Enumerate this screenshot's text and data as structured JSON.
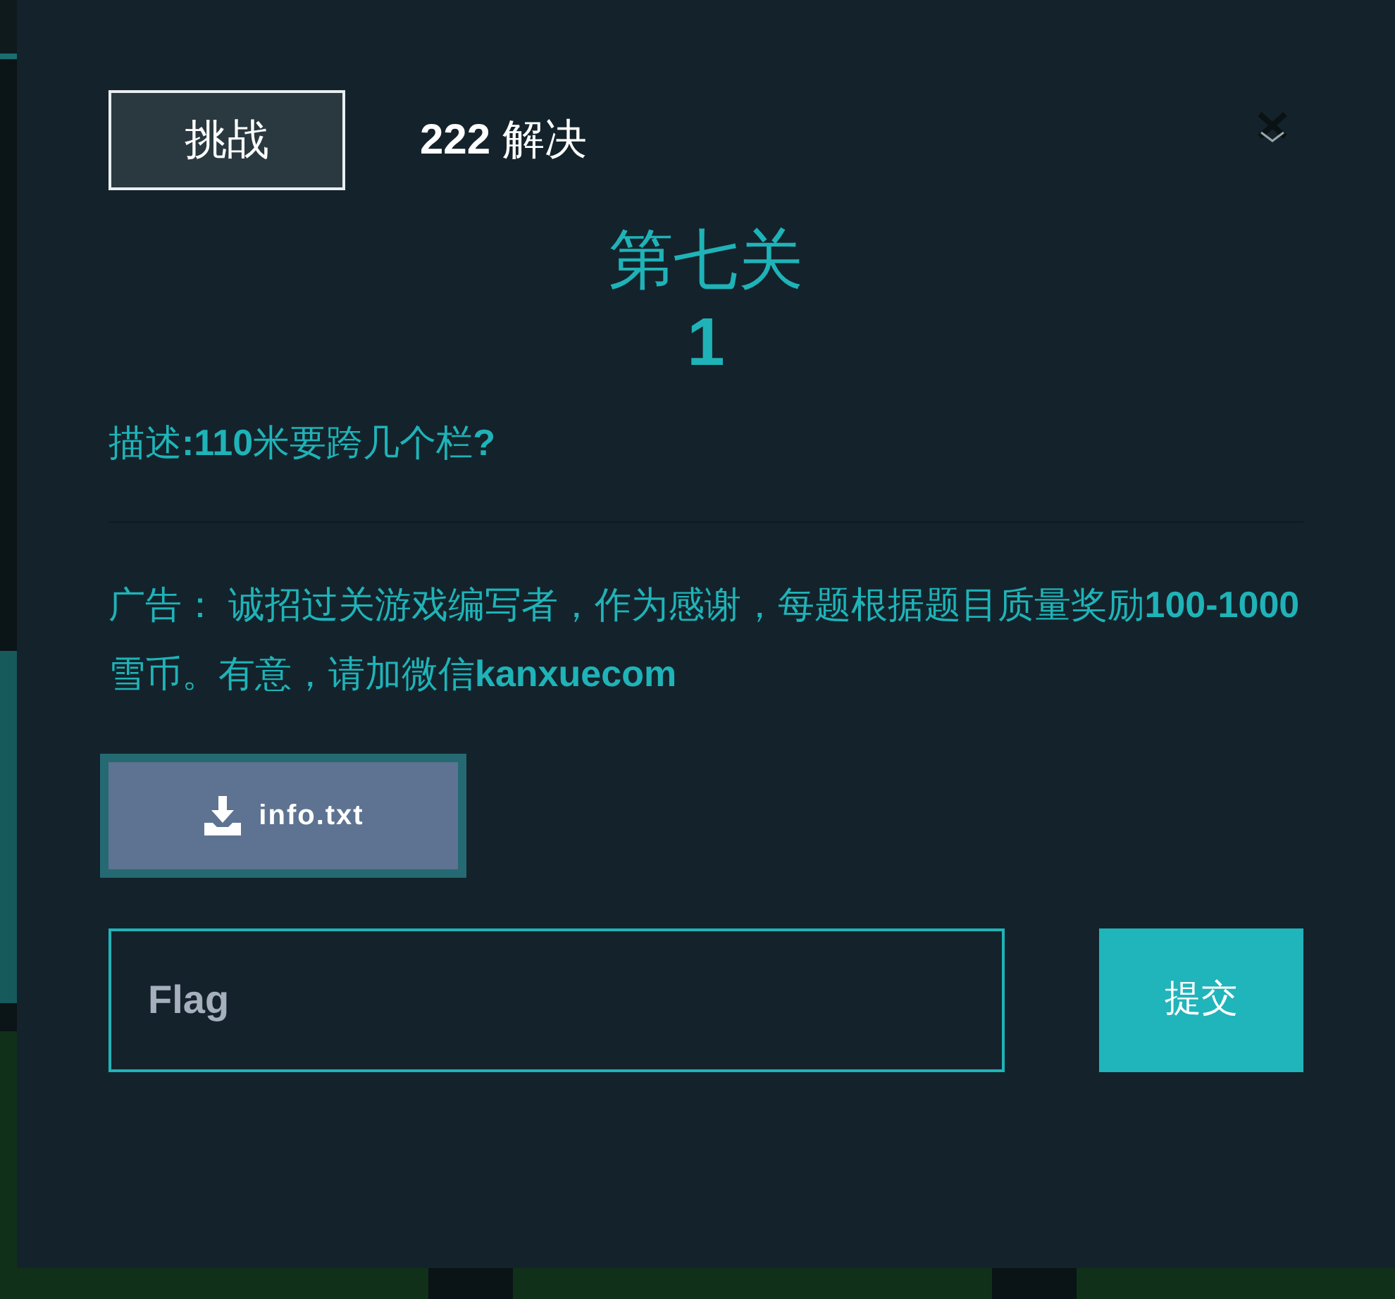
{
  "modal": {
    "tabs": [
      {
        "label": "挑战",
        "selected": true
      }
    ],
    "solves": {
      "count": "222",
      "label": "解决"
    },
    "title": "第七关",
    "points": "1",
    "description": "描述**:110**米要跨几个栏**?**",
    "announcement": "广告： 诚招过关游戏编写者，作为感谢，每题根据题目质量奖励**100-1000**雪币。有意，请加微信**kanxuecom**",
    "files": [
      "info.txt"
    ],
    "flag_field": {
      "placeholder": "Flag"
    },
    "submit": "提交"
  }
}
